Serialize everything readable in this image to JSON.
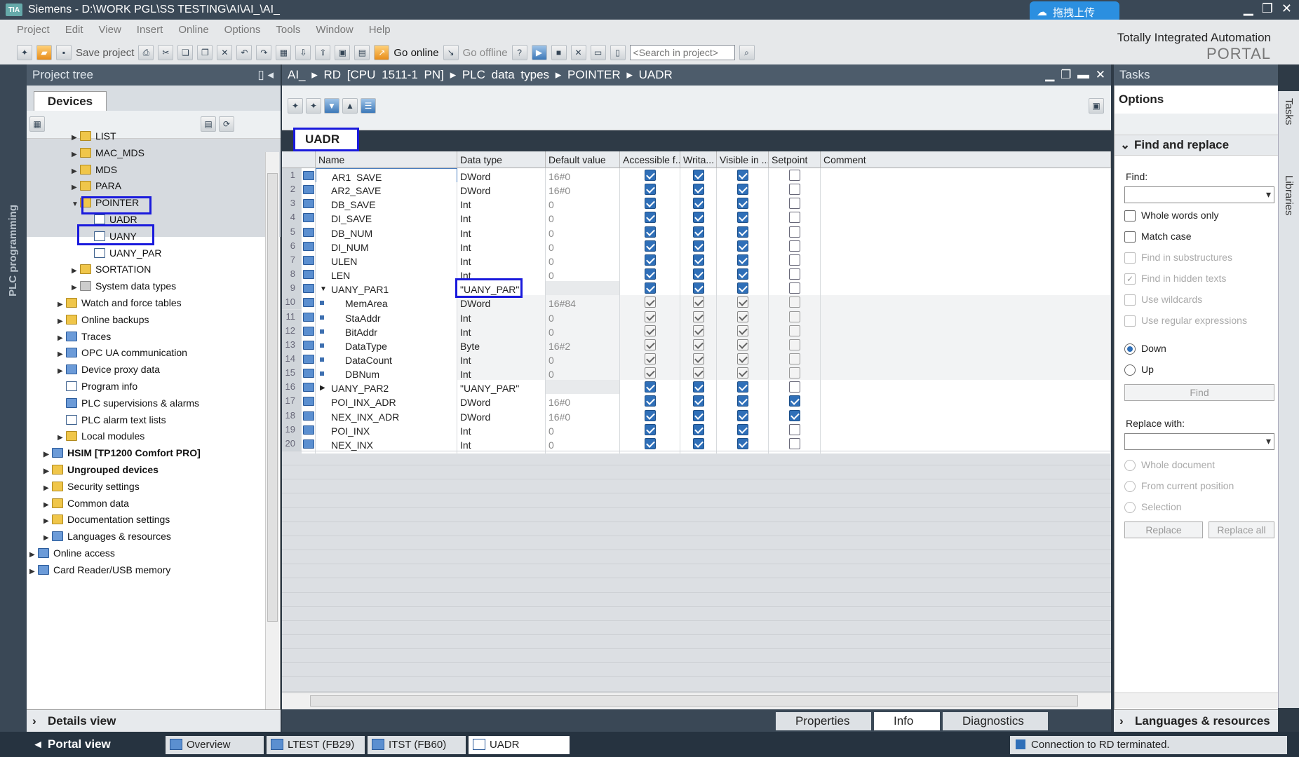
{
  "window": {
    "title": "Siemens  -  D:\\WORK PGL\\SS TESTING\\AI\\AI_\\AI_",
    "upload_button": "拖拽上传"
  },
  "menu": [
    "Project",
    "Edit",
    "View",
    "Insert",
    "Online",
    "Options",
    "Tools",
    "Window",
    "Help"
  ],
  "toolbar": {
    "save_label": "Save project",
    "go_online": "Go online",
    "go_offline": "Go offline",
    "search_placeholder": "<Search in project>"
  },
  "brand": {
    "line1": "Totally Integrated Automation",
    "line2": "PORTAL"
  },
  "left_strip_label": "PLC programming",
  "project_tree": {
    "title": "Project tree",
    "tab": "Devices",
    "items": [
      {
        "label": "LIST",
        "indent": 3,
        "arrow": "right",
        "icon": "folder"
      },
      {
        "label": "MAC_MDS",
        "indent": 3,
        "arrow": "right",
        "icon": "folder"
      },
      {
        "label": "MDS",
        "indent": 3,
        "arrow": "right",
        "icon": "folder"
      },
      {
        "label": "PARA",
        "indent": 3,
        "arrow": "right",
        "icon": "folder"
      },
      {
        "label": "POINTER",
        "indent": 3,
        "arrow": "down",
        "icon": "folder"
      },
      {
        "label": "UADR",
        "indent": 4,
        "arrow": "",
        "icon": "doc"
      },
      {
        "label": "UANY",
        "indent": 4,
        "arrow": "",
        "icon": "doc"
      },
      {
        "label": "UANY_PAR",
        "indent": 4,
        "arrow": "",
        "icon": "doc"
      },
      {
        "label": "SORTATION",
        "indent": 3,
        "arrow": "right",
        "icon": "folder"
      },
      {
        "label": "System data types",
        "indent": 3,
        "arrow": "right",
        "icon": "grey"
      },
      {
        "label": "Watch and force tables",
        "indent": 2,
        "arrow": "right",
        "icon": "folder"
      },
      {
        "label": "Online backups",
        "indent": 2,
        "arrow": "right",
        "icon": "folder"
      },
      {
        "label": "Traces",
        "indent": 2,
        "arrow": "right",
        "icon": "blue"
      },
      {
        "label": "OPC UA communication",
        "indent": 2,
        "arrow": "right",
        "icon": "blue"
      },
      {
        "label": "Device proxy data",
        "indent": 2,
        "arrow": "right",
        "icon": "blue"
      },
      {
        "label": "Program info",
        "indent": 2,
        "arrow": "",
        "icon": "doc"
      },
      {
        "label": "PLC supervisions & alarms",
        "indent": 2,
        "arrow": "",
        "icon": "blue"
      },
      {
        "label": "PLC alarm text lists",
        "indent": 2,
        "arrow": "",
        "icon": "doc"
      },
      {
        "label": "Local modules",
        "indent": 2,
        "arrow": "right",
        "icon": "folder"
      },
      {
        "label": "HSIM [TP1200 Comfort PRO]",
        "indent": 1,
        "arrow": "right",
        "icon": "blue",
        "bold": true
      },
      {
        "label": "Ungrouped devices",
        "indent": 1,
        "arrow": "right",
        "icon": "folder",
        "bold": true
      },
      {
        "label": "Security settings",
        "indent": 1,
        "arrow": "right",
        "icon": "folder"
      },
      {
        "label": "Common data",
        "indent": 1,
        "arrow": "right",
        "icon": "folder"
      },
      {
        "label": "Documentation settings",
        "indent": 1,
        "arrow": "right",
        "icon": "folder"
      },
      {
        "label": "Languages & resources",
        "indent": 1,
        "arrow": "right",
        "icon": "blue"
      },
      {
        "label": "Online access",
        "indent": 0,
        "arrow": "right",
        "icon": "blue"
      },
      {
        "label": "Card Reader/USB memory",
        "indent": 0,
        "arrow": "right",
        "icon": "blue"
      }
    ],
    "details_view": "Details view"
  },
  "editor": {
    "breadcrumb": "AI_  ▸  RD [CPU 1511-1 PN]  ▸  PLC data types  ▸  POINTER  ▸  UADR",
    "title": "UADR",
    "columns": [
      "Name",
      "Data type",
      "Default value",
      "Accessible f...",
      "Writa...",
      "Visible in ...",
      "Setpoint",
      "Comment"
    ],
    "rows": [
      {
        "n": "1",
        "name": "AR1_SAVE",
        "type": "DWord",
        "def": "16#0",
        "acc": true,
        "wr": true,
        "vis": true,
        "sp": false,
        "sub": false
      },
      {
        "n": "2",
        "name": "AR2_SAVE",
        "type": "DWord",
        "def": "16#0",
        "acc": true,
        "wr": true,
        "vis": true,
        "sp": false,
        "sub": false
      },
      {
        "n": "3",
        "name": "DB_SAVE",
        "type": "Int",
        "def": "0",
        "acc": true,
        "wr": true,
        "vis": true,
        "sp": false,
        "sub": false
      },
      {
        "n": "4",
        "name": "DI_SAVE",
        "type": "Int",
        "def": "0",
        "acc": true,
        "wr": true,
        "vis": true,
        "sp": false,
        "sub": false
      },
      {
        "n": "5",
        "name": "DB_NUM",
        "type": "Int",
        "def": "0",
        "acc": true,
        "wr": true,
        "vis": true,
        "sp": false,
        "sub": false
      },
      {
        "n": "6",
        "name": "DI_NUM",
        "type": "Int",
        "def": "0",
        "acc": true,
        "wr": true,
        "vis": true,
        "sp": false,
        "sub": false
      },
      {
        "n": "7",
        "name": "ULEN",
        "type": "Int",
        "def": "0",
        "acc": true,
        "wr": true,
        "vis": true,
        "sp": false,
        "sub": false
      },
      {
        "n": "8",
        "name": "LEN",
        "type": "Int",
        "def": "0",
        "acc": true,
        "wr": true,
        "vis": true,
        "sp": false,
        "sub": false
      },
      {
        "n": "9",
        "name": "UANY_PAR1",
        "type": "\"UANY_PAR\"",
        "def": "",
        "acc": true,
        "wr": true,
        "vis": true,
        "sp": false,
        "sub": false,
        "expand": "down"
      },
      {
        "n": "10",
        "name": "MemArea",
        "type": "DWord",
        "def": "16#84",
        "acc": true,
        "wr": true,
        "vis": true,
        "sp": false,
        "sub": true
      },
      {
        "n": "11",
        "name": "StaAddr",
        "type": "Int",
        "def": "0",
        "acc": true,
        "wr": true,
        "vis": true,
        "sp": false,
        "sub": true
      },
      {
        "n": "12",
        "name": "BitAddr",
        "type": "Int",
        "def": "0",
        "acc": true,
        "wr": true,
        "vis": true,
        "sp": false,
        "sub": true
      },
      {
        "n": "13",
        "name": "DataType",
        "type": "Byte",
        "def": "16#2",
        "acc": true,
        "wr": true,
        "vis": true,
        "sp": false,
        "sub": true
      },
      {
        "n": "14",
        "name": "DataCount",
        "type": "Int",
        "def": "0",
        "acc": true,
        "wr": true,
        "vis": true,
        "sp": false,
        "sub": true
      },
      {
        "n": "15",
        "name": "DBNum",
        "type": "Int",
        "def": "0",
        "acc": true,
        "wr": true,
        "vis": true,
        "sp": false,
        "sub": true
      },
      {
        "n": "16",
        "name": "UANY_PAR2",
        "type": "\"UANY_PAR\"",
        "def": "",
        "acc": true,
        "wr": true,
        "vis": true,
        "sp": false,
        "sub": false,
        "expand": "right"
      },
      {
        "n": "17",
        "name": "POI_INX_ADR",
        "type": "DWord",
        "def": "16#0",
        "acc": true,
        "wr": true,
        "vis": true,
        "sp": true,
        "sub": false
      },
      {
        "n": "18",
        "name": "NEX_INX_ADR",
        "type": "DWord",
        "def": "16#0",
        "acc": true,
        "wr": true,
        "vis": true,
        "sp": true,
        "sub": false
      },
      {
        "n": "19",
        "name": "POI_INX",
        "type": "Int",
        "def": "0",
        "acc": true,
        "wr": true,
        "vis": true,
        "sp": false,
        "sub": false
      },
      {
        "n": "20",
        "name": "NEX_INX",
        "type": "Int",
        "def": "0",
        "acc": true,
        "wr": true,
        "vis": true,
        "sp": false,
        "sub": false
      }
    ]
  },
  "inspector_tabs": [
    "Properties",
    "Info",
    "Diagnostics"
  ],
  "tasks": {
    "title": "Tasks",
    "options": "Options",
    "find_replace": "Find and replace",
    "find_label": "Find:",
    "checks": [
      {
        "label": "Whole words only",
        "enabled": true,
        "checked": false
      },
      {
        "label": "Match case",
        "enabled": true,
        "checked": false
      },
      {
        "label": "Find in substructures",
        "enabled": false,
        "checked": false
      },
      {
        "label": "Find in hidden texts",
        "enabled": false,
        "checked": true
      },
      {
        "label": "Use wildcards",
        "enabled": false,
        "checked": false
      },
      {
        "label": "Use regular expressions",
        "enabled": false,
        "checked": false
      }
    ],
    "dir_down": "Down",
    "dir_up": "Up",
    "find_btn": "Find",
    "replace_label": "Replace with:",
    "scope": [
      "Whole document",
      "From current position",
      "Selection"
    ],
    "replace_btn": "Replace",
    "replace_all_btn": "Replace all",
    "languages": "Languages & resources"
  },
  "side_tabs": [
    "Tasks",
    "Libraries"
  ],
  "taskbar": {
    "portal_view": "Portal view",
    "tasks": [
      "Overview",
      "LTEST (FB29)",
      "ITST (FB60)",
      "UADR"
    ],
    "status": "Connection to RD terminated."
  }
}
